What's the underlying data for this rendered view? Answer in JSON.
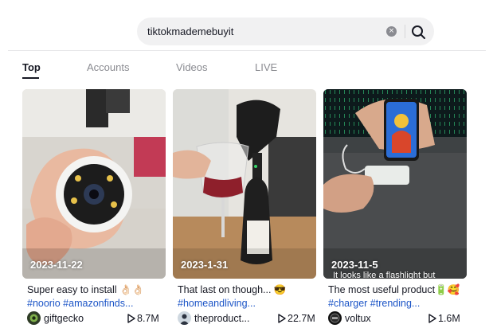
{
  "search": {
    "query": "tiktokmademebuyit",
    "clear_glyph": "×"
  },
  "tabs": [
    {
      "label": "Top",
      "active": true
    },
    {
      "label": "Accounts",
      "active": false
    },
    {
      "label": "Videos",
      "active": false
    },
    {
      "label": "LIVE",
      "active": false
    }
  ],
  "videos": [
    {
      "date": "2023-11-22",
      "description": "Super easy to install 👌🏻👌🏻",
      "hashtags": "#noorio #amazonfinds...",
      "author": "giftgecko",
      "views": "8.7M"
    },
    {
      "date": "2023-1-31",
      "description": "That last on though... 😎",
      "hashtags": "#homeandliving...",
      "author": "theproduct...",
      "views": "22.7M"
    },
    {
      "date": "2023-11-5",
      "overlay_caption": "It looks like a flashlight but",
      "description": "The most useful product🔋🥰",
      "hashtags": "#charger #trending...",
      "author": "voltux",
      "views": "1.6M"
    }
  ],
  "colors": {
    "accent_link": "#1c55c7",
    "text": "#161823",
    "muted": "#8a8b91",
    "search_bg": "#f1f1f2"
  }
}
